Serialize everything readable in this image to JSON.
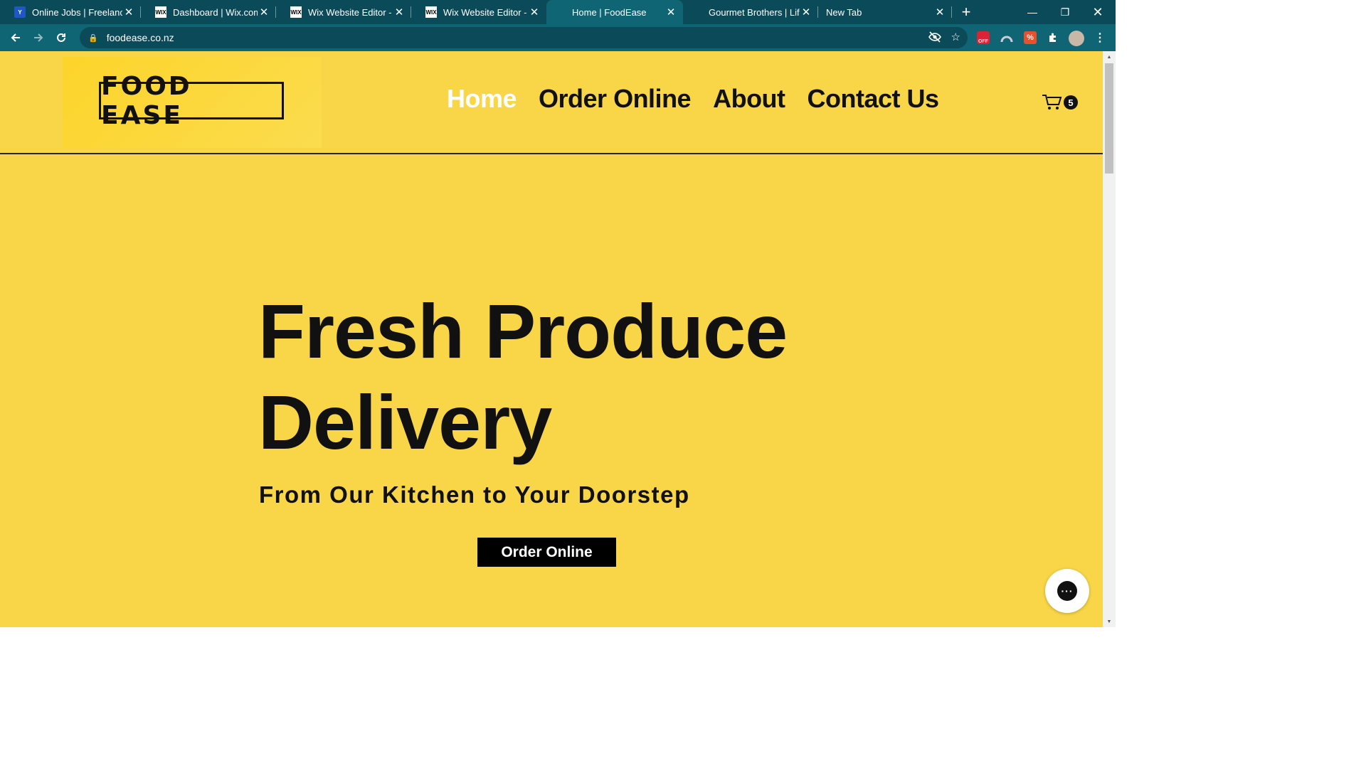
{
  "browser": {
    "tabs": [
      {
        "title": "Online Jobs | Freelance",
        "favicon": "upwork-icon"
      },
      {
        "title": "Dashboard | Wix.com",
        "favicon": "wix-icon"
      },
      {
        "title": "Wix Website Editor - go",
        "favicon": "wix-icon"
      },
      {
        "title": "Wix Website Editor - fo",
        "favicon": "wix-icon"
      },
      {
        "title": "Home | FoodEase",
        "favicon": "none"
      },
      {
        "title": "Gourmet Brothers | Life",
        "favicon": "none"
      },
      {
        "title": "New Tab",
        "favicon": "none"
      }
    ],
    "active_tab_index": 4,
    "url": "foodease.co.nz",
    "wix_favicon_text": "WIX",
    "ext_badge_text": "OFF"
  },
  "site": {
    "logo": "FOOD EASE",
    "nav": [
      {
        "label": "Home",
        "active": true
      },
      {
        "label": "Order Online",
        "active": false
      },
      {
        "label": "About",
        "active": false
      },
      {
        "label": "Contact Us",
        "active": false
      }
    ],
    "cart_count": "5",
    "hero": {
      "title_line1": "Fresh Produce",
      "title_line2": "Delivery",
      "subtitle": "From Our Kitchen to Your Doorstep",
      "cta": "Order Online"
    },
    "chat_icon_text": "···"
  },
  "colors": {
    "page_background": "#f8d648",
    "browser_frame": "#0f6573",
    "text_dark": "#111111",
    "nav_active": "#ffffff",
    "cta_background": "#000000"
  }
}
